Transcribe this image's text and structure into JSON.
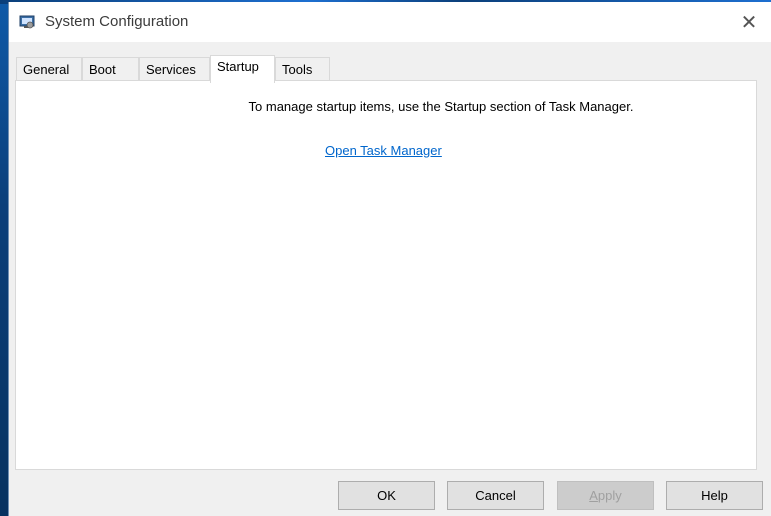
{
  "window": {
    "title": "System Configuration",
    "close_symbol": "✕"
  },
  "tabs": [
    {
      "label": "General",
      "active": false
    },
    {
      "label": "Boot",
      "active": false
    },
    {
      "label": "Services",
      "active": false
    },
    {
      "label": "Startup",
      "active": true
    },
    {
      "label": "Tools",
      "active": false
    }
  ],
  "startup_panel": {
    "message": "To manage startup items, use the Startup section of Task Manager.",
    "link_text": "Open Task Manager"
  },
  "buttons": {
    "ok": "OK",
    "cancel": "Cancel",
    "apply_prefix": "A",
    "apply_rest": "pply",
    "help": "Help"
  },
  "colors": {
    "link": "#0066cc",
    "window_bg": "#f0f0f0",
    "panel_bg": "#ffffff"
  },
  "icons": {
    "app": "msconfig-icon",
    "close": "close-icon"
  }
}
